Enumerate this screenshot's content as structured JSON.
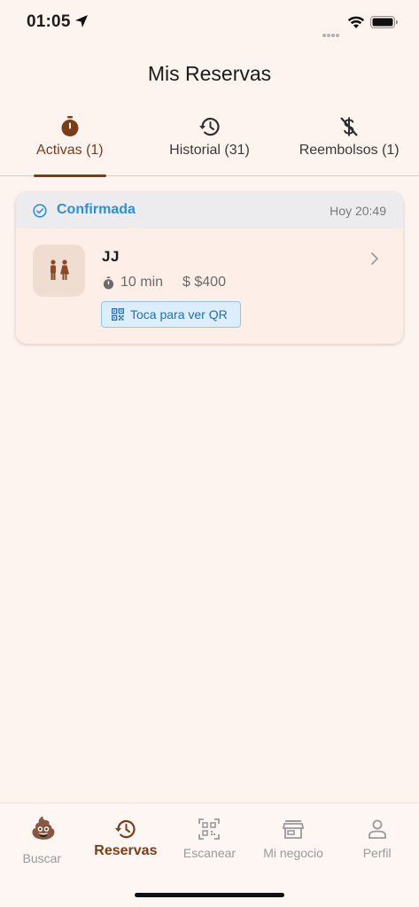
{
  "status_bar": {
    "time": "01:05"
  },
  "header": {
    "title": "Mis Reservas"
  },
  "tabs": [
    {
      "label": "Activas (1)",
      "icon": "stopwatch-icon",
      "active": true
    },
    {
      "label": "Historial (31)",
      "icon": "history-icon",
      "active": false
    },
    {
      "label": "Reembolsos (1)",
      "icon": "money-off-icon",
      "active": false
    }
  ],
  "reservation": {
    "status": "Confirmada",
    "time": "Hoy 20:49",
    "venue": "JJ",
    "duration": "10 min",
    "price": "$ $400",
    "qr_label": "Toca para ver QR",
    "status_color": "#2c8fd9"
  },
  "bottom_nav": [
    {
      "label": "Buscar",
      "icon": "poop-emoji-icon",
      "active": false
    },
    {
      "label": "Reservas",
      "icon": "history-icon",
      "active": true
    },
    {
      "label": "Escanear",
      "icon": "qr-scan-icon",
      "active": false
    },
    {
      "label": "Mi negocio",
      "icon": "store-icon",
      "active": false
    },
    {
      "label": "Perfil",
      "icon": "person-icon",
      "active": false
    }
  ],
  "colors": {
    "accent": "#7a3d17",
    "background": "#fdf3ef",
    "link_blue": "#2c8fd9"
  }
}
